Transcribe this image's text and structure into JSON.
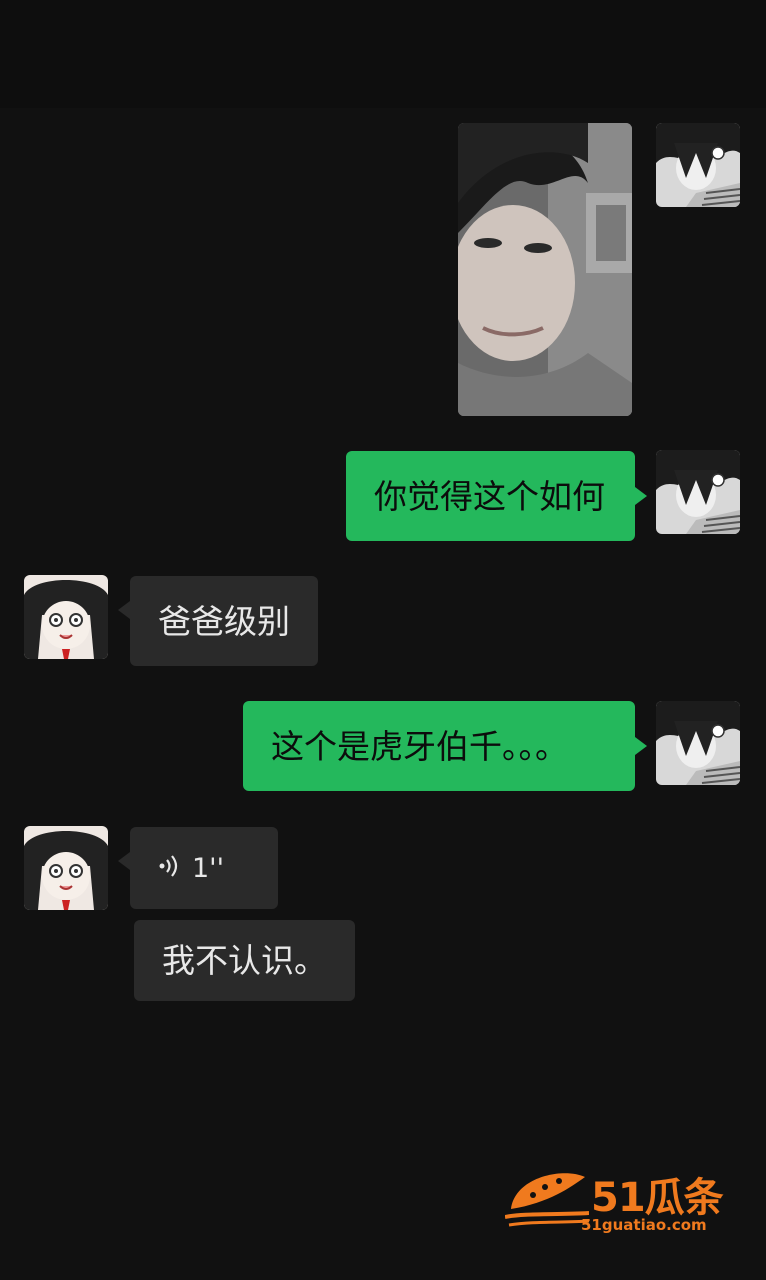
{
  "conversation": {
    "messages": [
      {
        "side": "right",
        "kind": "image",
        "content": "photo"
      },
      {
        "side": "right",
        "kind": "text",
        "text": "你觉得这个如何"
      },
      {
        "side": "left",
        "kind": "text",
        "text": "爸爸级别"
      },
      {
        "side": "right",
        "kind": "text",
        "text": "这个是虎牙伯千。。。"
      },
      {
        "side": "left",
        "kind": "voice",
        "duration": "1''"
      },
      {
        "side": "left",
        "kind": "text",
        "text": "我不认识。"
      }
    ]
  },
  "watermark": {
    "brand": "51瓜条",
    "domain": "51guatiao.com",
    "color": "#f07a1e"
  },
  "colors": {
    "background": "#111111",
    "sent_bubble": "#24b85c",
    "received_bubble": "#2a2a2a"
  }
}
